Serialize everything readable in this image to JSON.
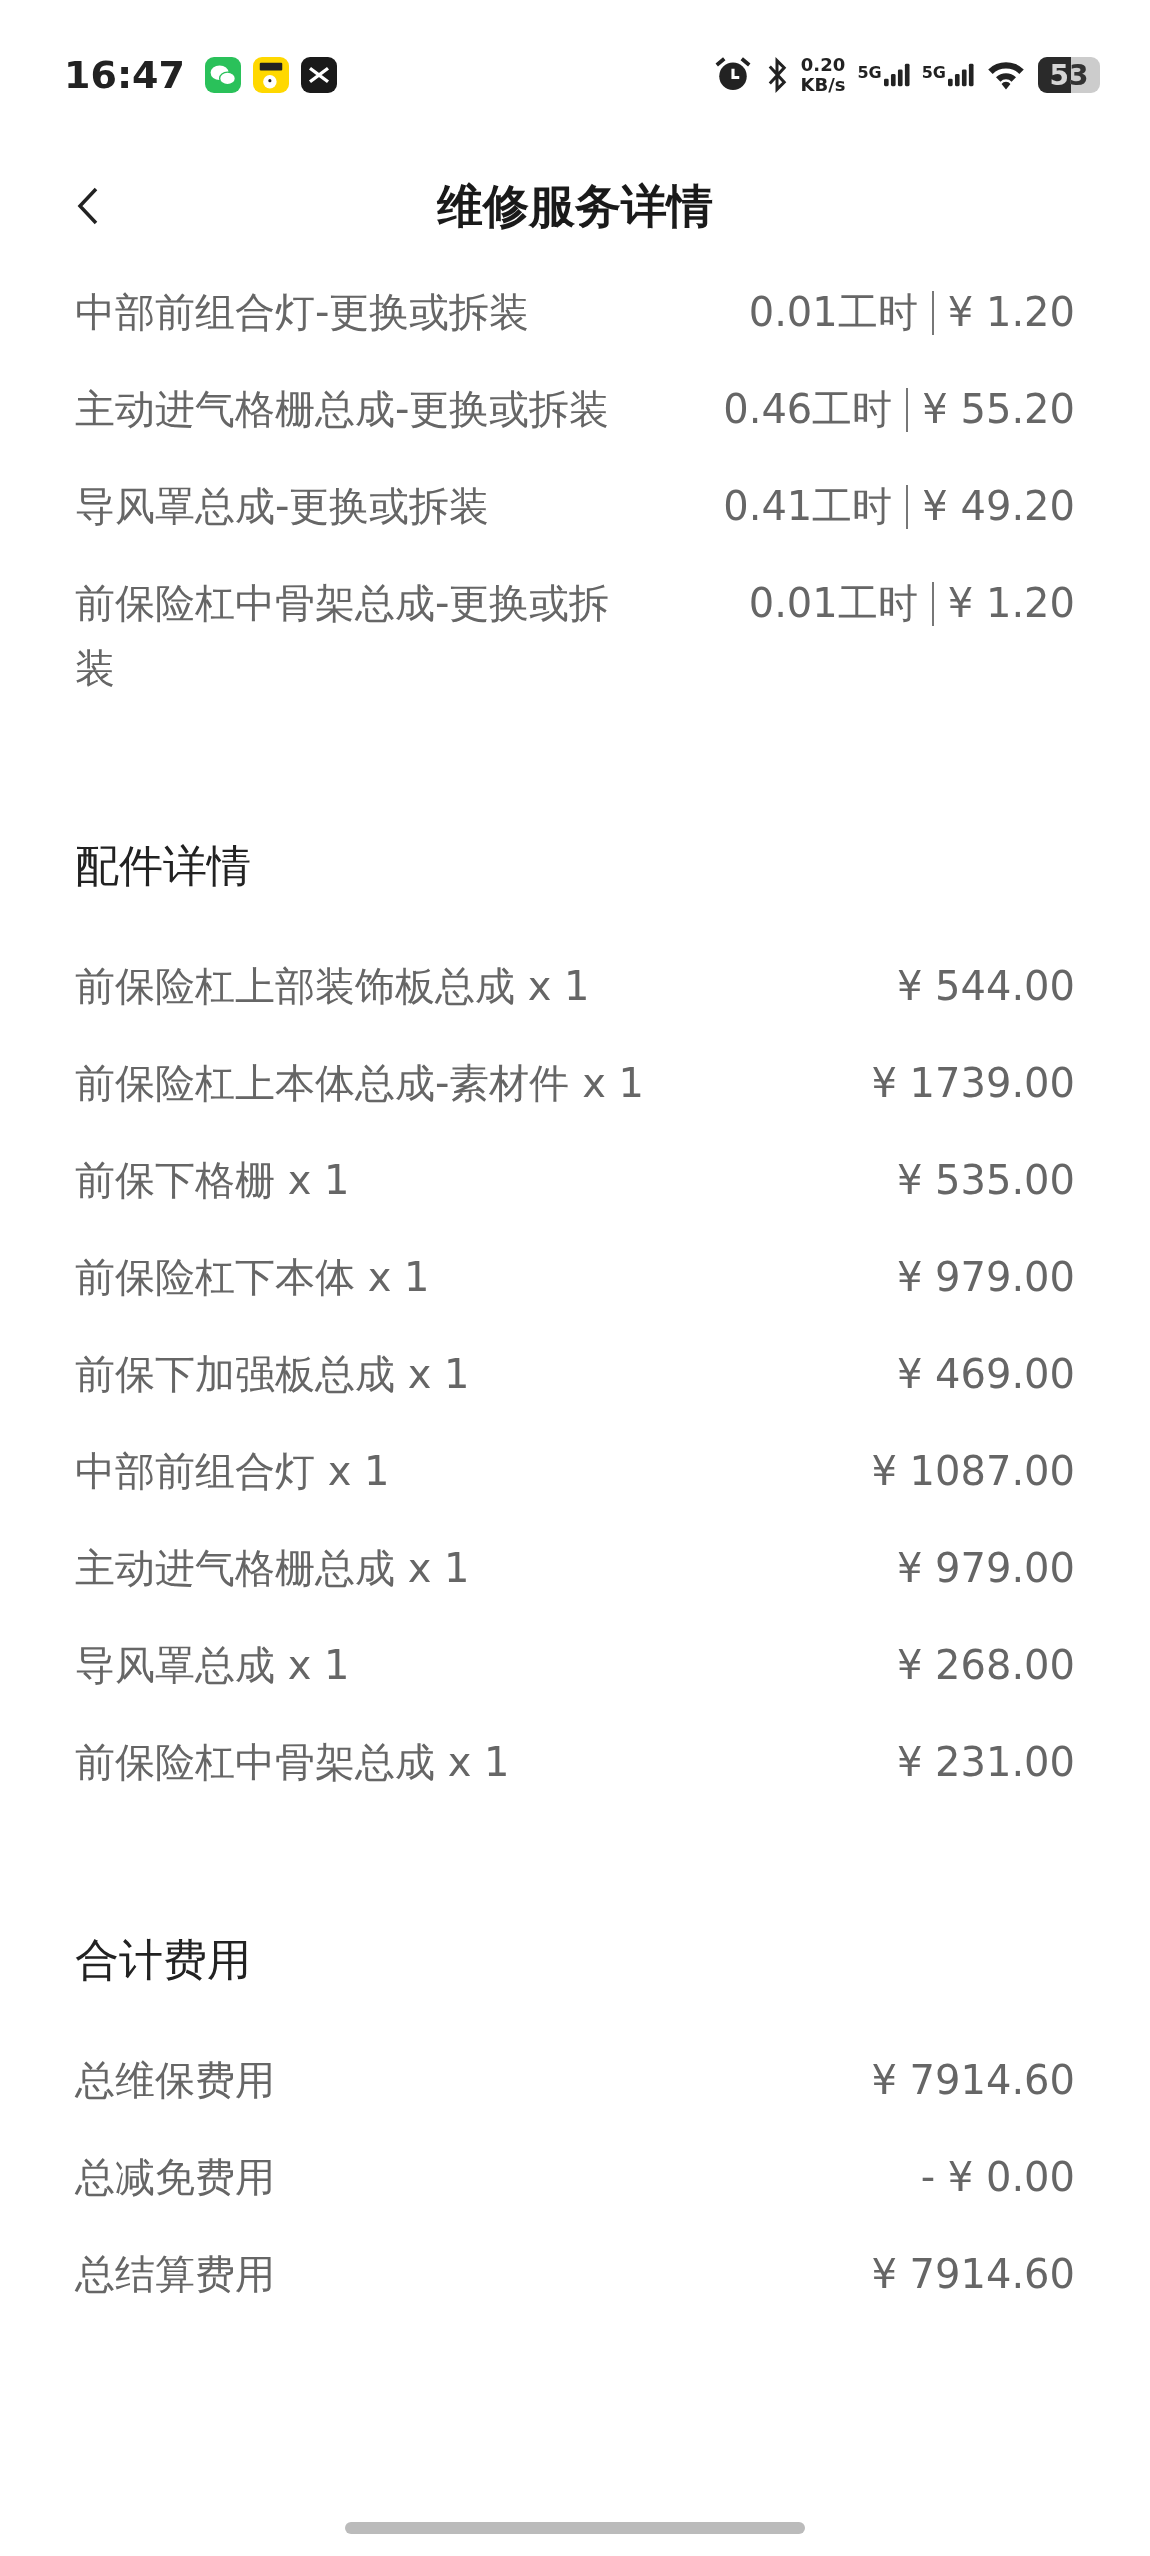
{
  "status_bar": {
    "time": "16:47",
    "net_speed": "0.20",
    "net_unit": "KB/s",
    "signals": [
      "5G",
      "5G"
    ],
    "battery": "53"
  },
  "header": {
    "title": "维修服务详情"
  },
  "labor_items": [
    {
      "name": "中部前组合灯-更换或拆装",
      "hours": "0.01工时",
      "price": "¥ 1.20"
    },
    {
      "name": "主动进气格栅总成-更换或拆装",
      "hours": "0.46工时",
      "price": "¥ 55.20"
    },
    {
      "name": "导风罩总成-更换或拆装",
      "hours": "0.41工时",
      "price": "¥ 49.20"
    },
    {
      "name": "前保险杠中骨架总成-更换或拆装",
      "hours": "0.01工时",
      "price": "¥ 1.20"
    }
  ],
  "parts_section": {
    "title": "配件详情",
    "items": [
      {
        "name": "前保险杠上部装饰板总成 x 1",
        "price": "¥ 544.00"
      },
      {
        "name": "前保险杠上本体总成-素材件 x 1",
        "price": "¥ 1739.00"
      },
      {
        "name": "前保下格栅 x 1",
        "price": "¥ 535.00"
      },
      {
        "name": "前保险杠下本体 x 1",
        "price": "¥ 979.00"
      },
      {
        "name": "前保下加强板总成 x 1",
        "price": "¥ 469.00"
      },
      {
        "name": "中部前组合灯 x 1",
        "price": "¥ 1087.00"
      },
      {
        "name": "主动进气格栅总成 x 1",
        "price": "¥ 979.00"
      },
      {
        "name": "导风罩总成 x 1",
        "price": "¥ 268.00"
      },
      {
        "name": "前保险杠中骨架总成 x 1",
        "price": "¥ 231.00"
      }
    ]
  },
  "totals_section": {
    "title": "合计费用",
    "items": [
      {
        "name": "总维保费用",
        "price": "¥ 7914.60"
      },
      {
        "name": "总减免费用",
        "price": "- ¥ 0.00"
      },
      {
        "name": "总结算费用",
        "price": "¥ 7914.60"
      }
    ]
  }
}
